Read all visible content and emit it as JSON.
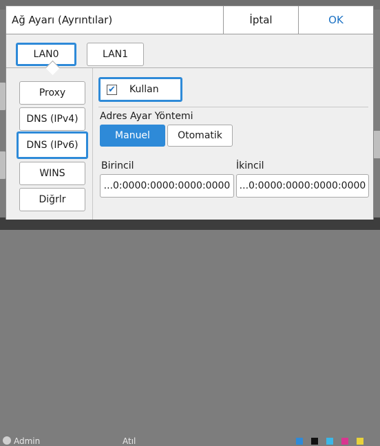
{
  "background": {
    "user": "Admin",
    "status": "Atıl"
  },
  "dialog": {
    "title": "Ağ Ayarı (Ayrıntılar)",
    "cancel_label": "İptal",
    "ok_label": "OK",
    "tabs": [
      {
        "label": "LAN0",
        "selected": true
      },
      {
        "label": "LAN1",
        "selected": false
      }
    ],
    "sidebar": [
      {
        "label": "Proxy",
        "selected": false
      },
      {
        "label": "DNS (IPv4)",
        "selected": false
      },
      {
        "label": "DNS (IPv6)",
        "selected": true
      },
      {
        "label": "WINS",
        "selected": false
      },
      {
        "label": "Diğrlr",
        "selected": false
      }
    ],
    "use_checkbox": {
      "label": "Kullan",
      "checked": true
    },
    "address_method": {
      "label": "Adres Ayar Yöntemi",
      "options": [
        "Manuel",
        "Otomatik"
      ],
      "selected": "Manuel"
    },
    "primary": {
      "label": "Birincil",
      "value": "...0:0000:0000:0000:0000"
    },
    "secondary": {
      "label": "İkincil",
      "value": "...0:0000:0000:0000:0000"
    }
  },
  "colors": {
    "accent": "#2e8ad8",
    "ok_text": "#1c72c4"
  }
}
